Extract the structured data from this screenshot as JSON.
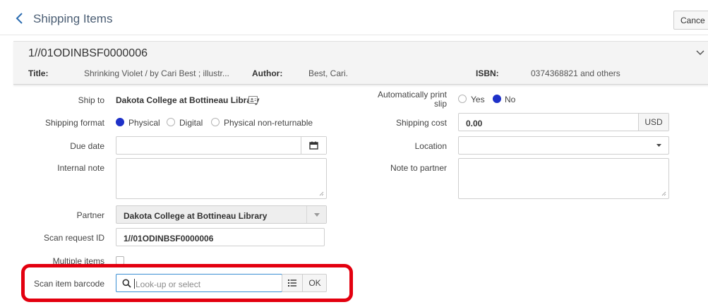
{
  "header": {
    "title": "Shipping Items",
    "cancel_label": "Cance"
  },
  "record": {
    "id": "1//01ODINBSF0000006",
    "title_label": "Title:",
    "title_value": "Shrinking Violet / by Cari Best ; illustr...",
    "author_label": "Author:",
    "author_value": "Best, Cari.",
    "isbn_label": "ISBN:",
    "isbn_value": "0374368821 and others"
  },
  "form": {
    "ship_to": {
      "label": "Ship to",
      "value": "Dakota College at Bottineau Library"
    },
    "shipping_format": {
      "label": "Shipping format",
      "options": [
        "Physical",
        "Digital",
        "Physical non-returnable"
      ],
      "selected": "Physical"
    },
    "due_date": {
      "label": "Due date",
      "value": ""
    },
    "internal_note": {
      "label": "Internal note",
      "value": ""
    },
    "partner": {
      "label": "Partner",
      "value": "Dakota College at Bottineau Library"
    },
    "scan_request_id": {
      "label": "Scan request ID",
      "value": "1//01ODINBSF0000006"
    },
    "multiple_items": {
      "label": "Multiple items",
      "checked": false
    },
    "scan_item_barcode": {
      "label": "Scan item barcode",
      "placeholder": "Look-up or select",
      "ok_label": "OK"
    },
    "auto_print": {
      "label_line1": "Automatically print",
      "label_line2": "slip",
      "options": [
        "Yes",
        "No"
      ],
      "selected": "No"
    },
    "shipping_cost": {
      "label": "Shipping cost",
      "value": "0.00",
      "currency": "USD"
    },
    "location": {
      "label": "Location",
      "value": ""
    },
    "note_to_partner": {
      "label": "Note to partner",
      "value": ""
    }
  },
  "colors": {
    "accent": "#1e31c8",
    "highlight": "#e3000f",
    "title": "#4a5d73"
  }
}
